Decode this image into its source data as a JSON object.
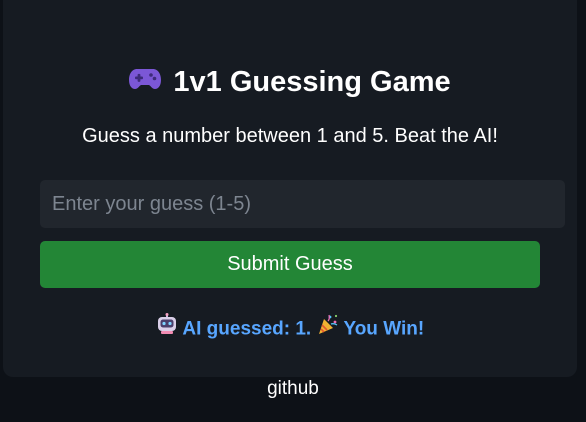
{
  "title": {
    "icon": "game-controller-icon",
    "text": "1v1 Guessing Game"
  },
  "subtitle": "Guess a number between 1 and 5. Beat the AI!",
  "guess_input": {
    "placeholder": "Enter your guess (1-5)",
    "value": ""
  },
  "submit_button": {
    "label": "Submit Guess"
  },
  "result": {
    "ai_icon": "robot-icon",
    "ai_text": "AI guessed: 1.",
    "win_icon": "party-popper-icon",
    "win_text": "You Win!"
  },
  "footer": {
    "link_label": "github"
  },
  "colors": {
    "page_background": "#0d1117",
    "card_background": "#161b22",
    "input_background": "#21262d",
    "button_green": "#238636",
    "result_blue": "#58a6ff"
  }
}
